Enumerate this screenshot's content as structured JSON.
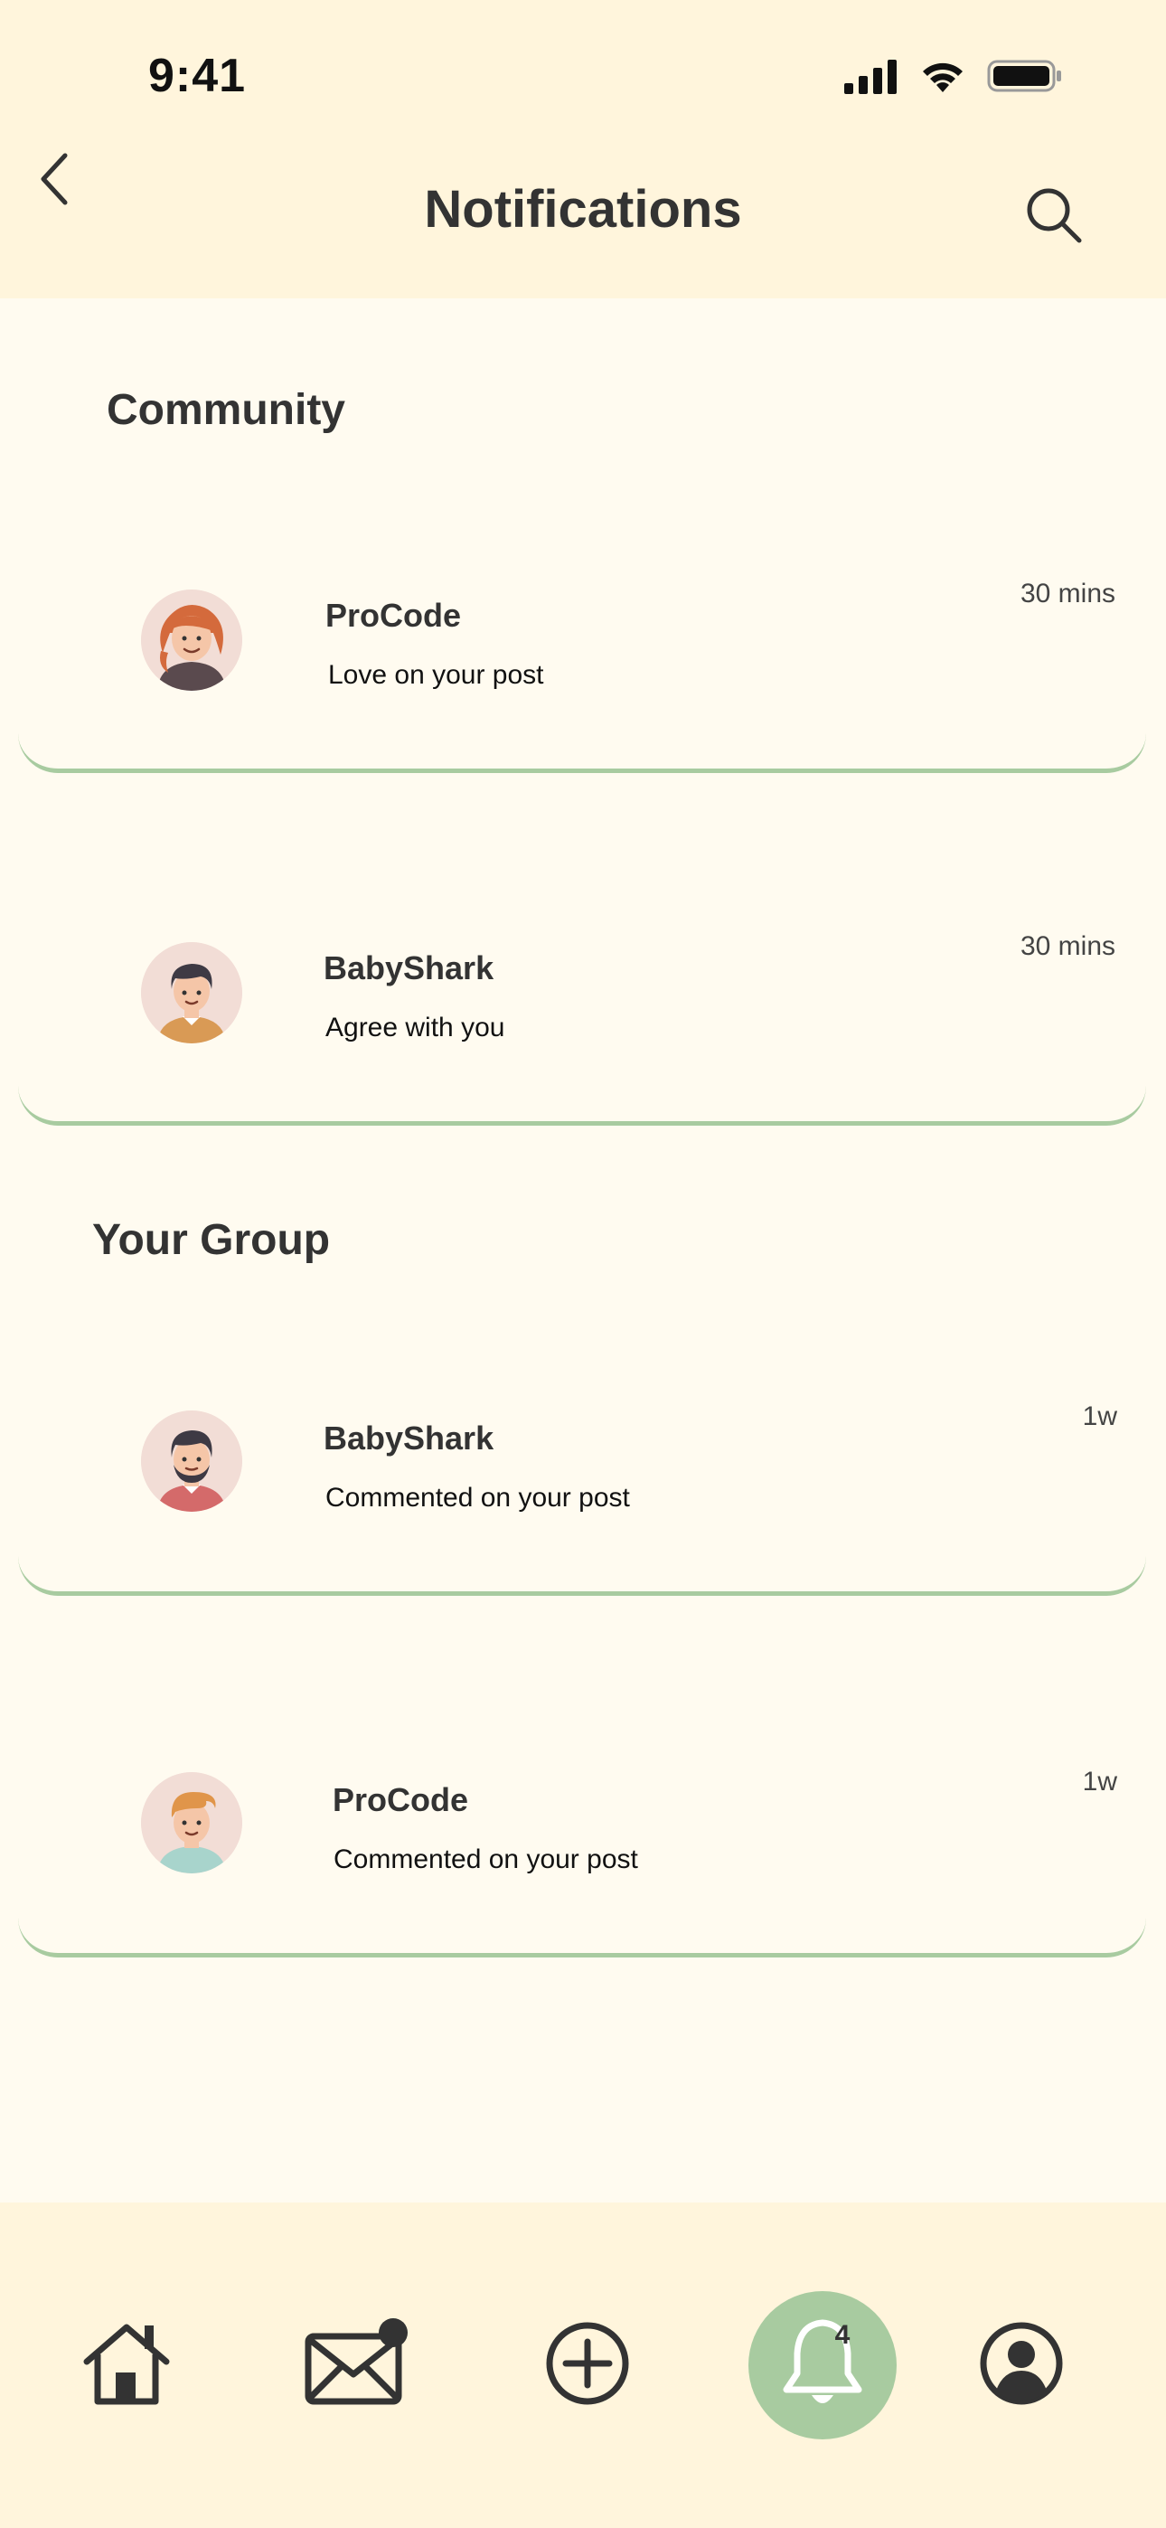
{
  "status_bar": {
    "time": "9:41",
    "icons": [
      "cellular-signal-icon",
      "wifi-icon",
      "battery-icon"
    ]
  },
  "header": {
    "title": "Notifications",
    "back_icon": "chevron-left-icon",
    "search_icon": "search-icon"
  },
  "sections": [
    {
      "heading": "Community",
      "items": [
        {
          "name": "ProCode",
          "message": "Love on your post",
          "time": "30 mins",
          "avatar": "woman-red-hair-avatar"
        },
        {
          "name": "BabyShark",
          "message": "Agree with you",
          "time": "30 mins",
          "avatar": "man-dark-hair-avatar"
        }
      ]
    },
    {
      "heading": "Your Group",
      "items": [
        {
          "name": "BabyShark",
          "message": "Commented on your post",
          "time": "1w",
          "avatar": "man-beard-avatar"
        },
        {
          "name": "ProCode",
          "message": "Commented on your post",
          "time": "1w",
          "avatar": "man-ginger-hair-avatar"
        }
      ]
    }
  ],
  "bottom_nav": {
    "items": [
      "home-icon",
      "mail-icon",
      "add-icon",
      "bell-icon",
      "profile-icon"
    ],
    "active": "bell-icon",
    "notification_count": "4"
  },
  "colors": {
    "header_bg": "#FFF5DC",
    "page_bg": "#FFFBF0",
    "accent_green": "#A8CBA0",
    "text_dark": "#333333"
  }
}
